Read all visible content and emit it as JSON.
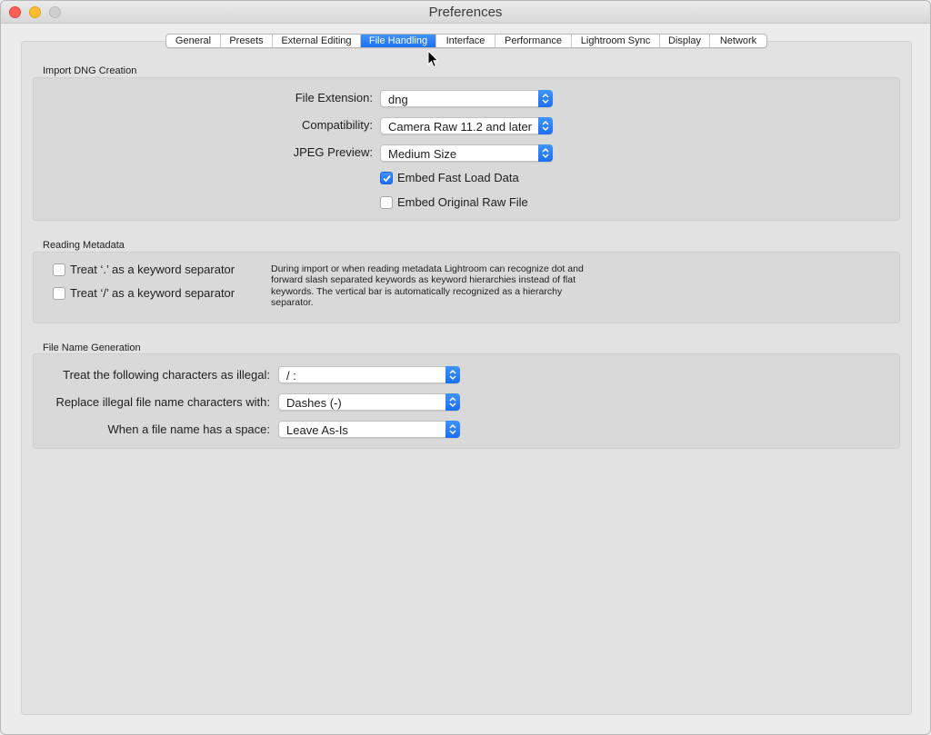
{
  "window": {
    "title": "Preferences"
  },
  "tabs": [
    {
      "label": "General"
    },
    {
      "label": "Presets"
    },
    {
      "label": "External Editing"
    },
    {
      "label": "File Handling",
      "active": true
    },
    {
      "label": "Interface"
    },
    {
      "label": "Performance"
    },
    {
      "label": "Lightroom Sync"
    },
    {
      "label": "Display"
    },
    {
      "label": "Network"
    }
  ],
  "dng": {
    "section_title": "Import DNG Creation",
    "file_extension_label": "File Extension:",
    "file_extension_value": "dng",
    "compatibility_label": "Compatibility:",
    "compatibility_value": "Camera Raw 11.2 and later",
    "jpeg_preview_label": "JPEG Preview:",
    "jpeg_preview_value": "Medium Size",
    "embed_fast_load_label": "Embed Fast Load Data",
    "embed_fast_load_checked": true,
    "embed_original_label": "Embed Original Raw File",
    "embed_original_checked": false
  },
  "metadata": {
    "section_title": "Reading Metadata",
    "dot_separator_label": "Treat ‘.’ as a keyword separator",
    "slash_separator_label": "Treat ‘/’ as a keyword separator",
    "description": "During import or when reading metadata Lightroom can recognize dot and forward slash separated keywords as keyword hierarchies instead of flat keywords. The vertical bar is automatically recognized as a hierarchy separator."
  },
  "filename": {
    "section_title": "File Name Generation",
    "illegal_chars_label": "Treat the following characters as illegal:",
    "illegal_chars_value": "/ :",
    "replace_label": "Replace illegal file name characters with:",
    "replace_value": "Dashes (-)",
    "space_label": "When a file name has a space:",
    "space_value": "Leave As-Is"
  },
  "colors": {
    "accent": "#1b6ff2",
    "close": "#fe5f57",
    "minimize": "#febc2e"
  }
}
